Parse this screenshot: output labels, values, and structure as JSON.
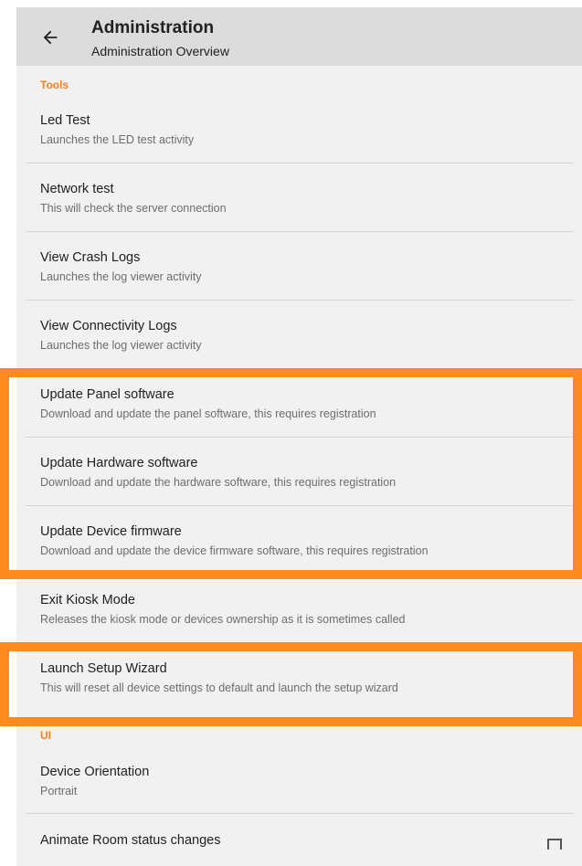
{
  "appbar": {
    "title": "Administration",
    "subtitle": "Administration Overview"
  },
  "sections": {
    "tools": "Tools",
    "ui": "UI"
  },
  "items": [
    {
      "title": "Led Test",
      "summary": "Launches the LED test activity"
    },
    {
      "title": "Network test",
      "summary": "This will check the server connection"
    },
    {
      "title": "View Crash Logs",
      "summary": "Launches the log viewer activity"
    },
    {
      "title": "View Connectivity Logs",
      "summary": "Launches the log viewer activity"
    },
    {
      "title": "Update Panel software",
      "summary": "Download and update the panel software, this requires registration"
    },
    {
      "title": "Update Hardware software",
      "summary": "Download and update the hardware software, this requires registration"
    },
    {
      "title": "Update Device firmware",
      "summary": "Download and update the device firmware software, this requires registration"
    },
    {
      "title": "Exit Kiosk Mode",
      "summary": "Releases the kiosk mode or devices ownership as it is sometimes called"
    },
    {
      "title": "Launch Setup Wizard",
      "summary": "This will reset all device settings to default and launch the setup wizard"
    }
  ],
  "ui_items": [
    {
      "title": "Device Orientation",
      "summary": "Portrait"
    },
    {
      "title": "Animate Room status changes",
      "checked": false
    }
  ],
  "colors": {
    "accent": "#f58220",
    "highlight": "#ff8a1f"
  }
}
